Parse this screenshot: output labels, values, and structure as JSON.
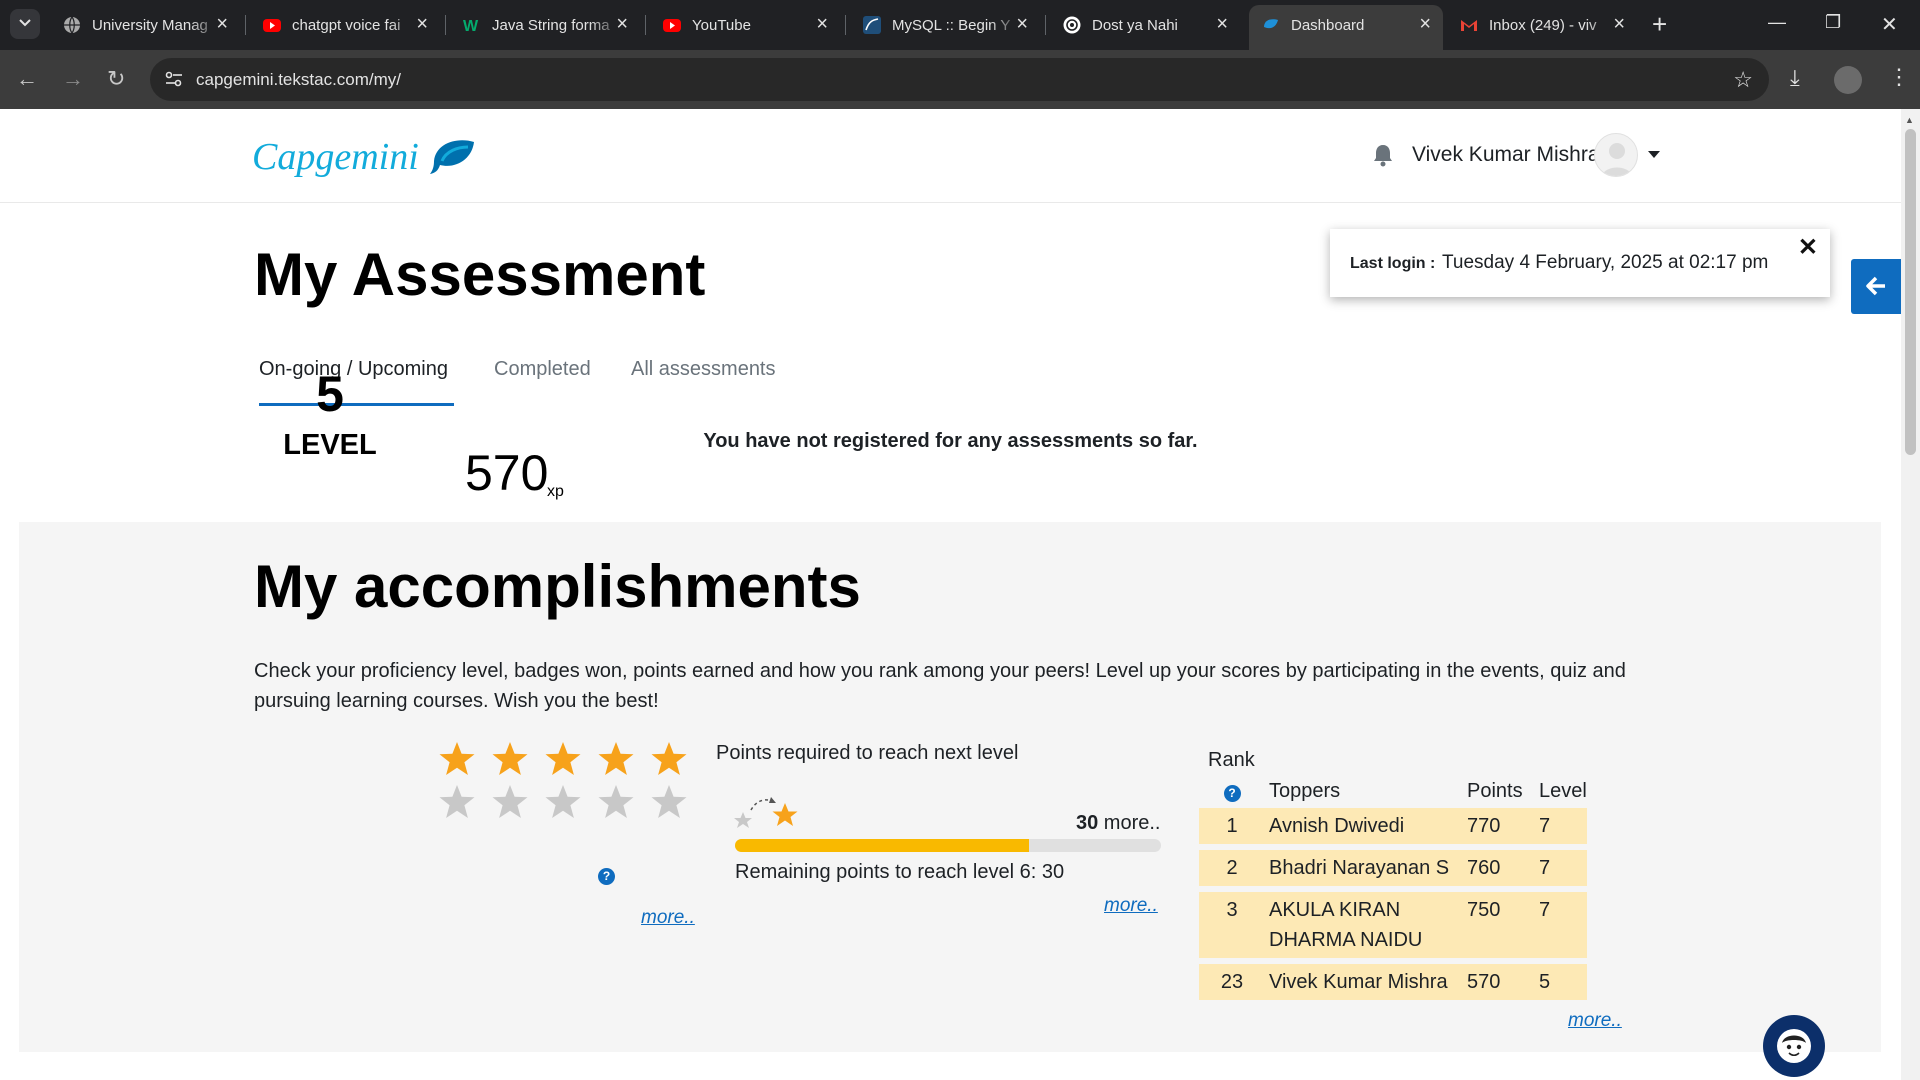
{
  "browser": {
    "tabs": [
      {
        "title": "University Manag",
        "icon": "globe-icon"
      },
      {
        "title": "chatgpt voice fai",
        "icon": "youtube-icon"
      },
      {
        "title": "Java String forma",
        "icon": "w3schools-icon"
      },
      {
        "title": "YouTube",
        "icon": "youtube-icon"
      },
      {
        "title": "MySQL :: Begin Y",
        "icon": "mysql-icon"
      },
      {
        "title": "Dost ya Nahi",
        "icon": "openai-icon"
      },
      {
        "title": "Dashboard",
        "icon": "capgemini-icon",
        "active": true
      },
      {
        "title": "Inbox (249) - viv",
        "icon": "gmail-icon"
      }
    ],
    "url": "capgemini.tekstac.com/my/"
  },
  "header": {
    "logo_text": "Capgemini",
    "user_name": "Vivek Kumar Mishra"
  },
  "last_login": {
    "label": "Last login :",
    "value": "Tuesday 4 February, 2025 at 02:17 pm",
    "close": "✕"
  },
  "assessment": {
    "title": "My Assessment",
    "tabs": [
      "On-going / Upcoming",
      "Completed",
      "All assessments"
    ],
    "active_tab": 0,
    "empty_message": "You have not registered for any assessments so far."
  },
  "accomplishments": {
    "title": "My accomplishments",
    "description": "Check your proficiency level, badges won, points earned and how you rank among your peers! Level up your scores by participating in the events, quiz and pursuing learning courses. Wish you the best!",
    "level_number": "5",
    "level_label": "LEVEL",
    "stars_filled": 5,
    "stars_empty": 5,
    "xp_value": "570",
    "xp_unit": "xp",
    "help_symbol": "?",
    "more_label": "more..",
    "colors": {
      "star": "#f7a21b",
      "star_empty": "#c8c8c8",
      "progress": "#f9b900",
      "highlight": "#fde9b5",
      "accent": "#0f6cbf"
    }
  },
  "points": {
    "title": "Points required to reach next level",
    "more_number": "30",
    "more_suffix": " more..",
    "progress_fraction": 0.69,
    "remaining_text": "Remaining points to reach level 6: 30",
    "more_label": "more.."
  },
  "ranking": {
    "rank_header": "Rank",
    "columns": [
      "Toppers",
      "Points",
      "Level"
    ],
    "rows": [
      {
        "rank": "1",
        "name": "Avnish Dwivedi",
        "points": "770",
        "level": "7"
      },
      {
        "rank": "2",
        "name": "Bhadri Narayanan S",
        "points": "760",
        "level": "7"
      },
      {
        "rank": "3",
        "name": "AKULA KIRAN DHARMA NAIDU",
        "points": "750",
        "level": "7"
      },
      {
        "rank": "23",
        "name": "Vivek Kumar Mishra",
        "points": "570",
        "level": "5"
      }
    ],
    "more_label": "more.."
  }
}
